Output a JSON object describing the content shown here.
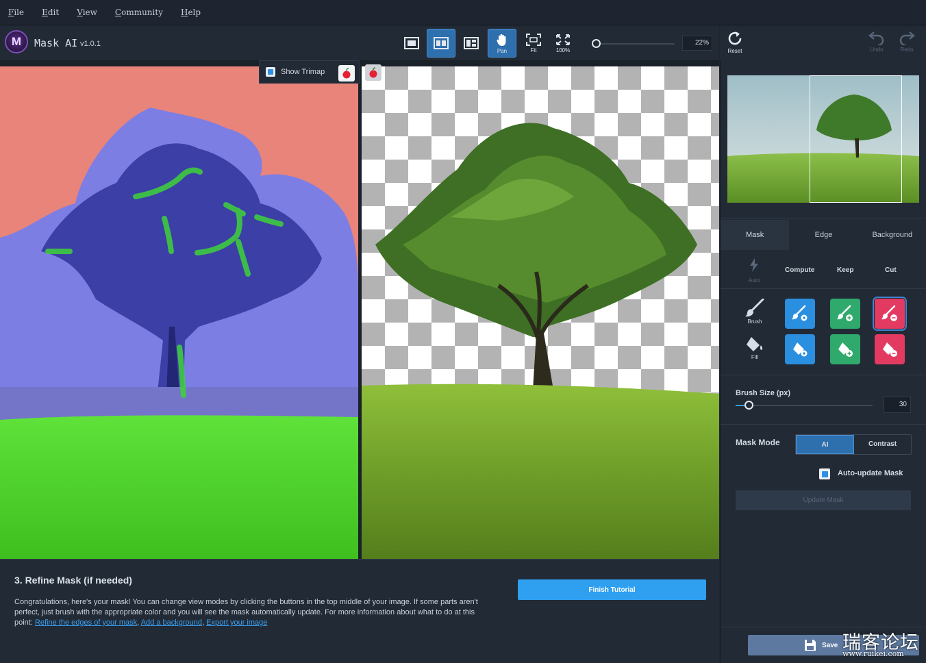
{
  "menu": [
    "File",
    "Edit",
    "View",
    "Community",
    "Help"
  ],
  "app": {
    "name": "Mask AI",
    "version": "v1.0.1",
    "logo_letter": "M"
  },
  "toolbar": {
    "pan_label": "Pan",
    "fit_label": "Fit",
    "zoom100_label": "100%",
    "zoom_value": "22%"
  },
  "history": {
    "reset_label": "Reset",
    "undo_label": "Undo",
    "redo_label": "Redo"
  },
  "canvas": {
    "show_trimap_label": "Show Trimap",
    "show_trimap_checked": true
  },
  "panel": {
    "tabs": [
      "Mask",
      "Edge",
      "Background"
    ],
    "active_tab": "Mask",
    "tool_headers": {
      "auto": "Auto",
      "compute": "Compute",
      "keep": "Keep",
      "cut": "Cut"
    },
    "brush_label": "Brush",
    "fill_label": "Fill",
    "brush_size_label": "Brush Size (px)",
    "brush_size_value": "30",
    "brush_size_max": 300,
    "mask_mode_label": "Mask Mode",
    "mask_modes": [
      "AI",
      "Contrast"
    ],
    "active_mask_mode": "AI",
    "auto_update_label": "Auto-update Mask",
    "auto_update_checked": true,
    "update_mask_label": "Update Mask",
    "save_label": "Save"
  },
  "colors": {
    "compute": "#2b8fe0",
    "keep": "#2fa96c",
    "cut": "#e33a62",
    "accent": "#2f9ff0"
  },
  "tutorial": {
    "title": "3. Refine Mask (if needed)",
    "body": "Congratulations, here's your mask! You can change view modes by clicking the buttons in the top middle of your image. If some parts aren't perfect, just brush with the appropriate color and you will see the mask automatically update. For more information about what to do at this point: ",
    "links": [
      "Refine the edges of your mask",
      "Add a background",
      "Export your image"
    ],
    "finish_label": "Finish Tutorial"
  },
  "watermark": {
    "text": "瑞客论坛",
    "url": "www.ruikei.com"
  }
}
